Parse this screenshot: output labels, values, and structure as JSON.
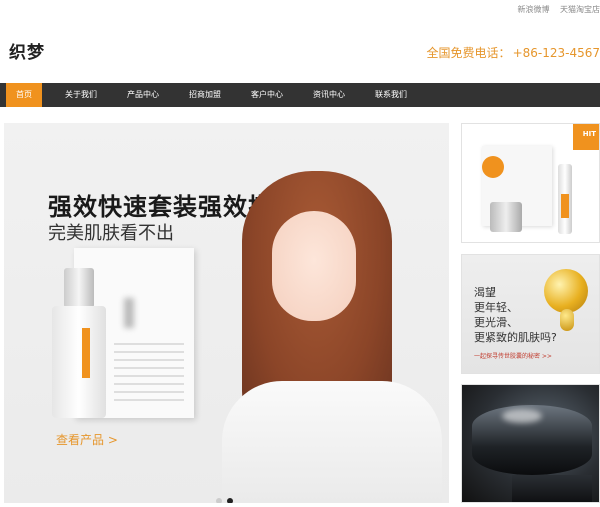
{
  "toplinks": [
    "新浪微博",
    "天猫淘宝店"
  ],
  "header": {
    "logo": "织梦",
    "hotline_label": "全国免费电话：",
    "hotline_number": "+86-123-4567"
  },
  "nav": [
    {
      "label": "首页",
      "active": true
    },
    {
      "label": "关于我们"
    },
    {
      "label": "产品中心"
    },
    {
      "label": "招商加盟"
    },
    {
      "label": "客户中心"
    },
    {
      "label": "资讯中心"
    },
    {
      "label": "联系我们"
    }
  ],
  "banner": {
    "headline": "强效快速套装强效搭配",
    "subline": "完美肌肤看不出",
    "cta": "查看产品 >",
    "slides": 2,
    "active_slide": 2
  },
  "side": {
    "panel1_badge": "HIT",
    "panel2_lines": [
      "渴望",
      "更年轻、",
      "更光滑、",
      "更紧致的肌肤吗?"
    ],
    "panel2_small": "一起探寻传世胶囊的秘密 >>"
  },
  "colors": {
    "accent": "#f0921e",
    "nav_bg": "#333333",
    "hotline": "#e6962c"
  }
}
